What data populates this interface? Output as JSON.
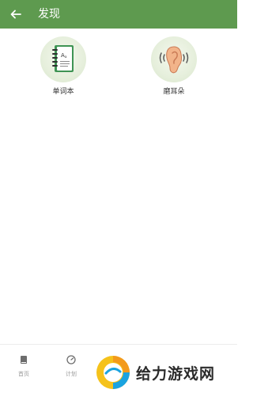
{
  "header": {
    "title": "发现",
    "back_icon": "arrow-left-icon",
    "background_color": "#5e9a4f"
  },
  "features": [
    {
      "label": "单词本",
      "icon": "notebook-icon"
    },
    {
      "label": "磨耳朵",
      "icon": "ear-icon"
    }
  ],
  "bottom_nav": [
    {
      "label": "首页",
      "icon": "book-icon"
    },
    {
      "label": "计划",
      "icon": "gauge-icon"
    }
  ],
  "watermark": {
    "text": "给力游戏网",
    "logo": "watermark-logo"
  }
}
